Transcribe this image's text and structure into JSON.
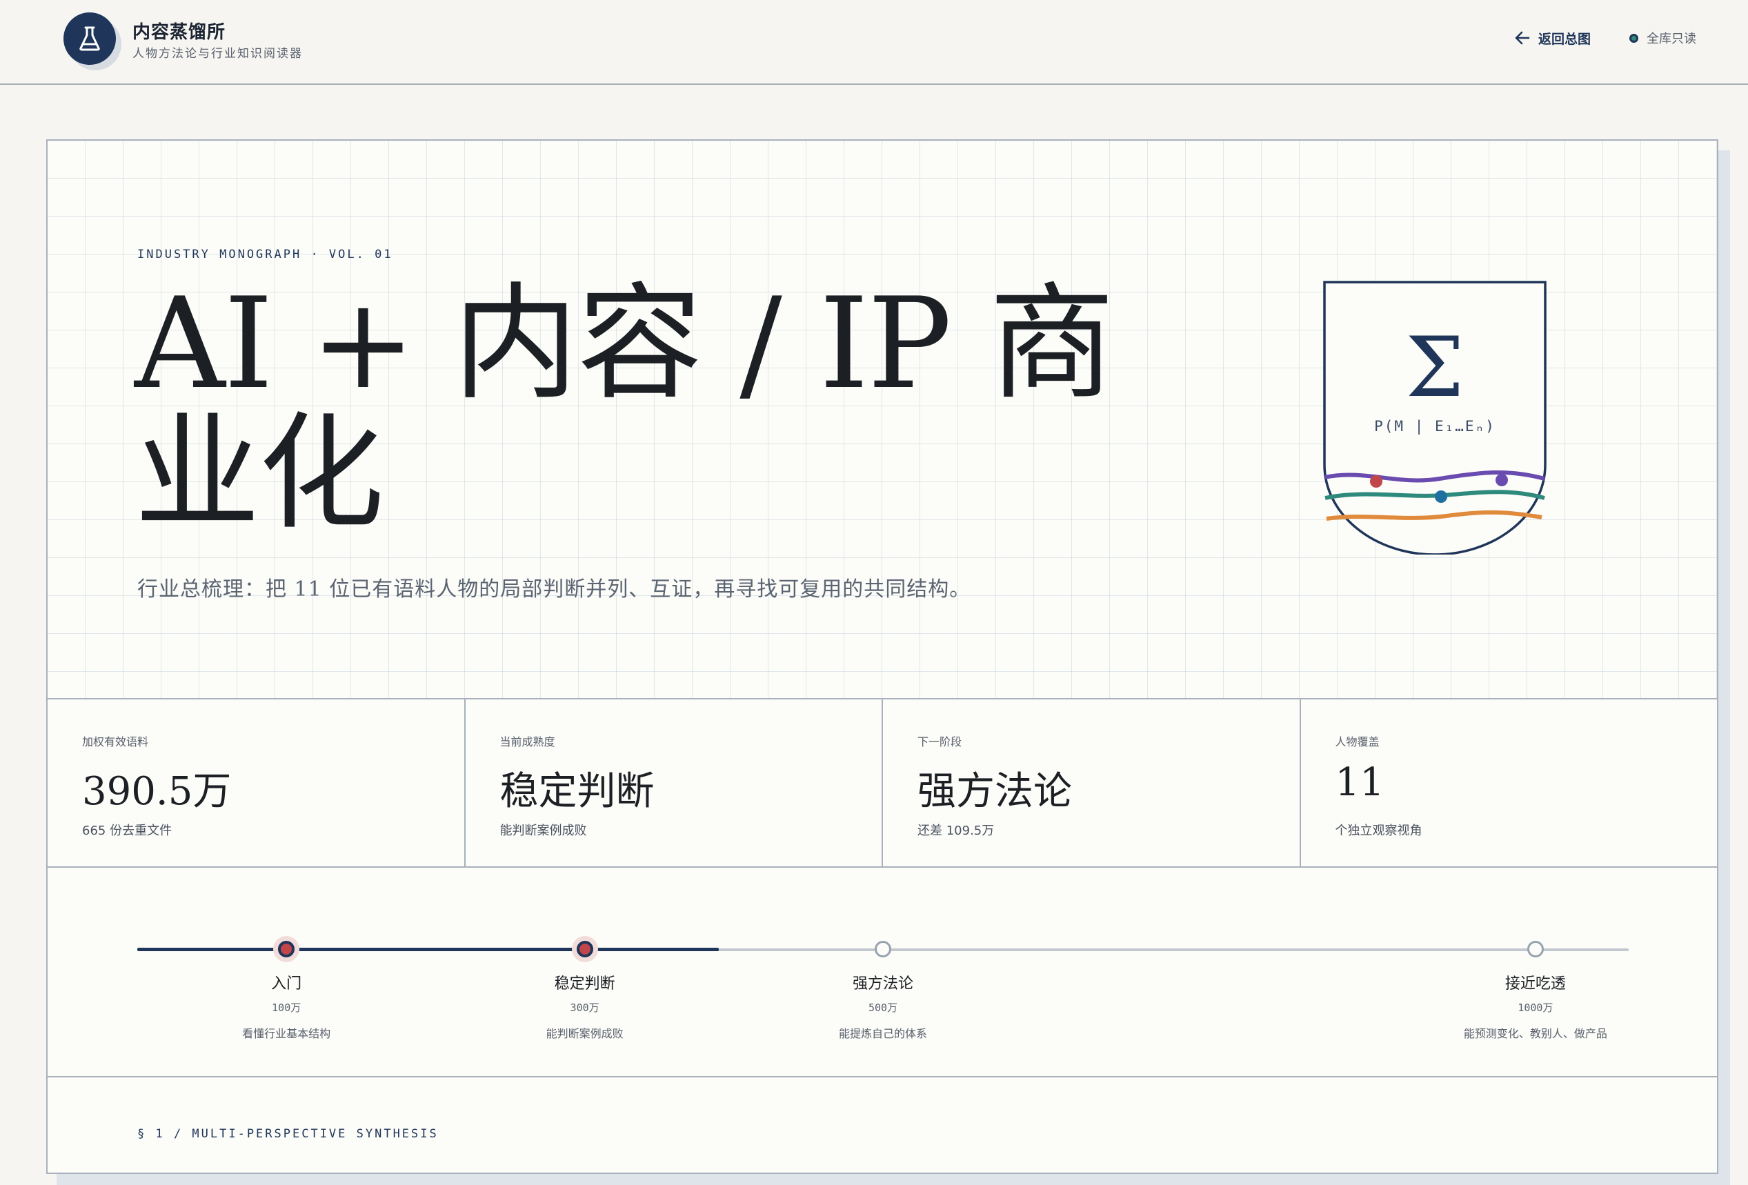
{
  "header": {
    "brand_title": "内容蒸馏所",
    "brand_subtitle": "人物方法论与行业知识阅读器",
    "back_label": "返回总图",
    "readonly_label": "全库只读"
  },
  "hero": {
    "kicker": "INDUSTRY MONOGRAPH · VOL. 01",
    "title": "AI + 内容 / IP 商业化",
    "subtitle": "行业总梳理：把 11 位已有语料人物的局部判断并列、互证，再寻找可复用的共同结构。",
    "emblem_symbol": "Σ",
    "emblem_formula": "P(M | E₁…Eₙ)"
  },
  "stats": [
    {
      "label": "加权有效语料",
      "value": "390.5万",
      "note": "665 份去重文件"
    },
    {
      "label": "当前成熟度",
      "value": "稳定判断",
      "note": "能判断案例成败"
    },
    {
      "label": "下一阶段",
      "value": "强方法论",
      "note": "还差 109.5万"
    },
    {
      "label": "人物覆盖",
      "value": "11",
      "note": "个独立观察视角"
    }
  ],
  "progress": {
    "fraction": 0.39,
    "milestones": [
      {
        "name": "入门",
        "amount": "100万",
        "desc": "看懂行业基本结构",
        "done": true,
        "value": 100
      },
      {
        "name": "稳定判断",
        "amount": "300万",
        "desc": "能判断案例成败",
        "done": true,
        "value": 300
      },
      {
        "name": "强方法论",
        "amount": "500万",
        "desc": "能提炼自己的体系",
        "done": false,
        "value": 500
      },
      {
        "name": "接近吃透",
        "amount": "1000万",
        "desc": "能预测变化、教别人、做产品",
        "done": false,
        "value": 1000
      }
    ]
  },
  "section": {
    "label": "§ 1 / MULTI-PERSPECTIVE SYNTHESIS"
  },
  "colors": {
    "navy": "#1f3559",
    "purple": "#6a4bb0",
    "teal": "#2f8a7e",
    "orange": "#e08a3c",
    "rose": "#c0464a"
  }
}
